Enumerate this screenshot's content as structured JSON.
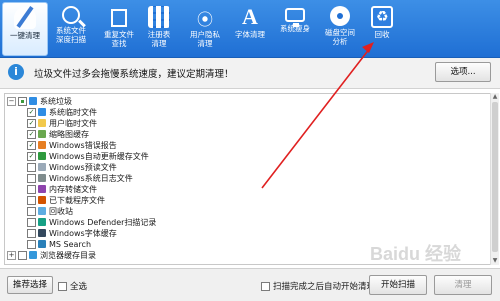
{
  "toolbar": {
    "items": [
      {
        "label": "一键清理",
        "icon": "broom-icon"
      },
      {
        "label": "系统文件\n深度扫描",
        "icon": "magnifier-icon"
      },
      {
        "label": "重复文件\n查找",
        "icon": "duplicate-files-icon"
      },
      {
        "label": "注册表\n清理",
        "icon": "registry-icon"
      },
      {
        "label": "用户隐私\n清理",
        "icon": "privacy-icon"
      },
      {
        "label": "字体清理",
        "icon": "font-icon"
      },
      {
        "label": "系统瘦身",
        "icon": "monitor-icon"
      },
      {
        "label": "磁盘空间\n分析",
        "icon": "disk-icon"
      },
      {
        "label": "回收",
        "icon": "recycle-icon"
      }
    ]
  },
  "info": {
    "text": "垃圾文件过多会拖慢系统速度，建议定期清理！",
    "options_button": "选项..."
  },
  "tree": {
    "items": [
      {
        "label": "系统垃圾",
        "expander": "−",
        "checked": "partial",
        "icon": "windows-icon"
      },
      {
        "label": "系统临时文件",
        "checked": true,
        "icon": "windows-icon"
      },
      {
        "label": "用户临时文件",
        "checked": true,
        "icon": "folder-icon"
      },
      {
        "label": "缩略图缓存",
        "checked": true,
        "icon": "image-icon"
      },
      {
        "label": "Windows错误报告",
        "checked": true,
        "icon": "report-icon"
      },
      {
        "label": "Windows自动更新缓存文件",
        "checked": true,
        "icon": "update-icon"
      },
      {
        "label": "Windows预读文件",
        "checked": false,
        "icon": "file-icon"
      },
      {
        "label": "Windows系统日志文件",
        "checked": false,
        "icon": "log-icon"
      },
      {
        "label": "内存转储文件",
        "checked": false,
        "icon": "dump-icon"
      },
      {
        "label": "已下载程序文件",
        "checked": false,
        "icon": "download-icon"
      },
      {
        "label": "回收站",
        "checked": false,
        "icon": "recycle-bin-icon"
      },
      {
        "label": "Windows Defender扫描记录",
        "checked": false,
        "icon": "defender-icon"
      },
      {
        "label": "Windows字体缓存",
        "checked": false,
        "icon": "font-cache-icon"
      },
      {
        "label": "MS Search",
        "checked": false,
        "icon": "search-icon"
      },
      {
        "label": "浏览器缓存目录",
        "expander": "+",
        "checked": false,
        "icon": "browser-icon"
      }
    ]
  },
  "bottom": {
    "recommend_button": "推荐选择",
    "select_all": "全选",
    "auto_clean": "扫描完成之后自动开始清理",
    "scan_button": "开始扫描",
    "clean_button": "清理"
  },
  "watermark": "Baidu 经验",
  "colors": {
    "toolbar_top": "#3d8fe6",
    "toolbar_bottom": "#1f6fd4",
    "arrow": "#e02020"
  }
}
